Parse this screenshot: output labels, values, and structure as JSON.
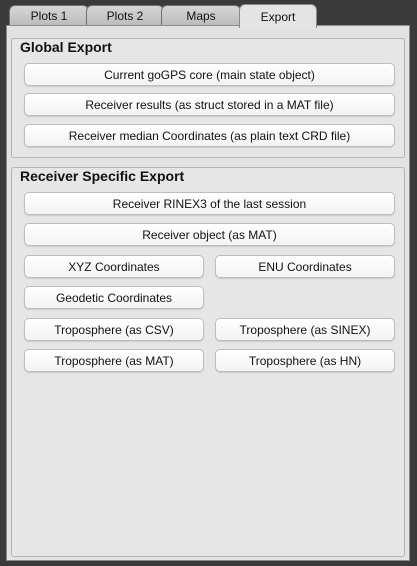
{
  "tabs": [
    {
      "label": "Plots 1"
    },
    {
      "label": "Plots 2"
    },
    {
      "label": "Maps"
    },
    {
      "label": "Export",
      "active": true
    }
  ],
  "global_export": {
    "title": "Global Export",
    "buttons": [
      "Current goGPS core (main state object)",
      "Receiver results (as struct stored in a MAT file)",
      "Receiver median Coordinates (as plain text CRD file)"
    ]
  },
  "receiver_export": {
    "title": "Receiver Specific Export",
    "rinex3": "Receiver RINEX3 of the last session",
    "object": "Receiver object (as MAT)",
    "xyz": "XYZ Coordinates",
    "enu": "ENU Coordinates",
    "geodetic": "Geodetic Coordinates",
    "tropo_csv": "Troposphere (as CSV)",
    "tropo_sinex": "Troposphere (as SINEX)",
    "tropo_mat": "Troposphere (as MAT)",
    "tropo_hn": "Troposphere (as HN)"
  }
}
